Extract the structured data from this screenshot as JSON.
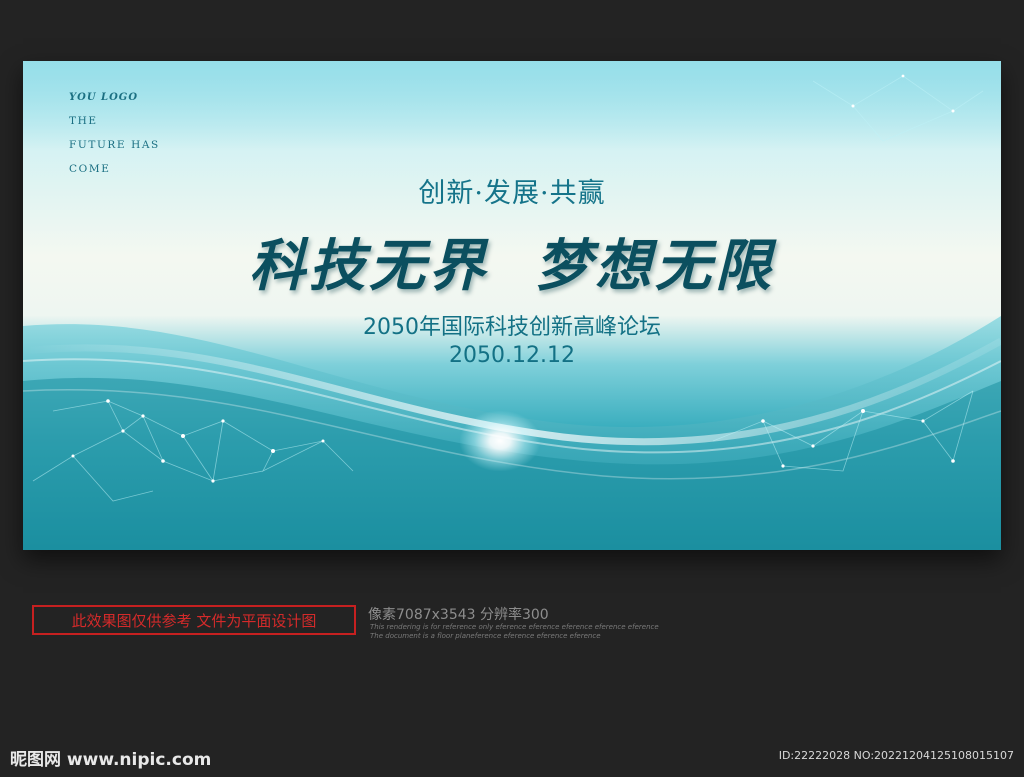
{
  "poster": {
    "logo": "YOU LOGO",
    "slogan_lines": [
      "THE",
      "FUTURE HAS",
      "COME"
    ],
    "subtitle": "创新·发展·共赢",
    "headline_left": "科技无界",
    "headline_right": "梦想无限",
    "forum_title": "2050年国际科技创新高峰论坛",
    "date": "2050.12.12"
  },
  "footer": {
    "disclaimer": "此效果图仅供参考 文件为平面设计图",
    "pixel_info": "像素7087x3543  分辨率300",
    "fine_line_1": "This rendering is for reference only  eference eference eference eference eference",
    "fine_line_2": "The document is a floor planeference eference eference eference",
    "watermark": "昵图网 www.nipic.com",
    "image_id": "ID:22222028 NO:20221204125108015107"
  },
  "colors": {
    "page_background": "#232323",
    "headline": "#0b4f5f",
    "text_teal": "#137185",
    "disclaimer_red": "#c62020"
  }
}
